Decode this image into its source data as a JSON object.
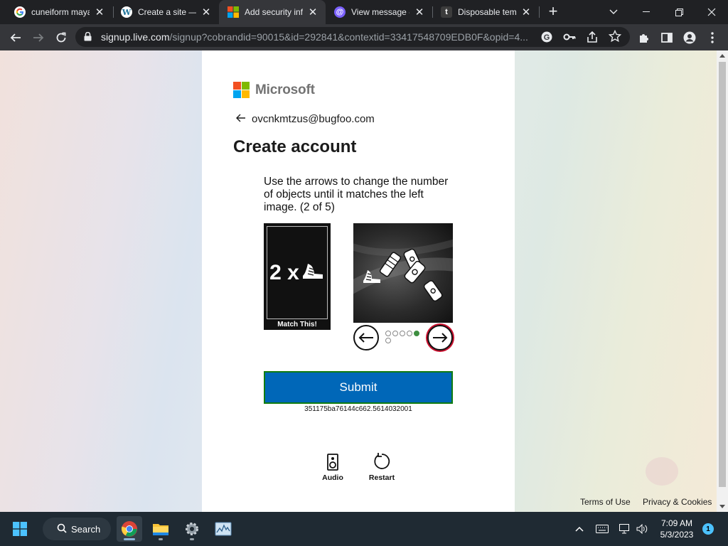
{
  "browser": {
    "tabs": [
      {
        "title": "cuneiform maya",
        "favicon": "google-icon"
      },
      {
        "title": "Create a site —",
        "favicon": "wordpress-icon"
      },
      {
        "title": "Add security inf",
        "favicon": "microsoft-icon",
        "active": true
      },
      {
        "title": "View message -",
        "favicon": "at-icon"
      },
      {
        "title": "Disposable tem",
        "favicon": "t-icon"
      }
    ],
    "new_tab_label": "+",
    "url_host": "signup.live.com",
    "url_rest": "/signup?cobrandid=90015&id=292841&contextid=33417548709EDB0F&opid=4..."
  },
  "page": {
    "brand": "Microsoft",
    "brand_colors": [
      "#f25022",
      "#7fba00",
      "#00a4ef",
      "#ffb900"
    ],
    "email": "ovcnkmtzus@bugfoo.com",
    "heading": "Create account",
    "captcha": {
      "instructions": "Use the arrows to change the number of objects until it matches the left image. (2 of 5)",
      "match_text": "2 x",
      "match_label": "Match This!",
      "dots_total": 6,
      "dot_active_index": 4,
      "submit_label": "Submit",
      "session_id": "351175ba76144c662.5614032001",
      "audio_label": "Audio",
      "restart_label": "Restart"
    },
    "footer": {
      "terms": "Terms of Use",
      "privacy": "Privacy & Cookies"
    }
  },
  "taskbar": {
    "search_label": "Search",
    "time": "7:09 AM",
    "date": "5/3/2023",
    "notification_count": "1"
  }
}
